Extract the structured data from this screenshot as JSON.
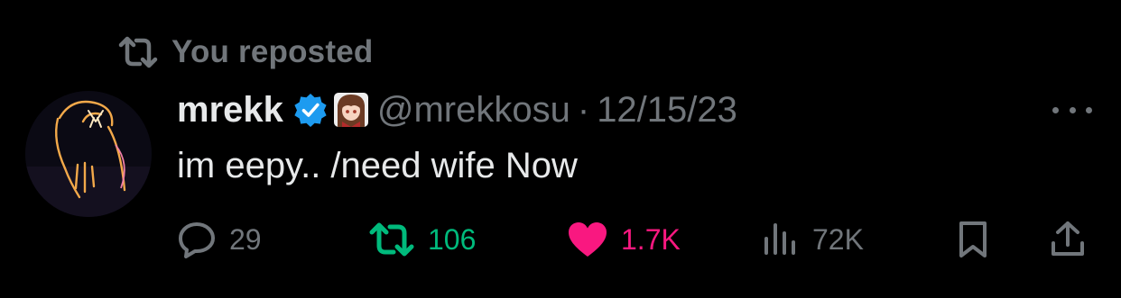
{
  "social_context": {
    "icon": "repost-icon",
    "text": "You reposted"
  },
  "author": {
    "display_name": "mrekk",
    "verified_icon": "verified-badge-icon",
    "badge_icon": "anime-girl-emoji-icon",
    "handle": "@mrekkosu",
    "separator": "·",
    "date": "12/15/23"
  },
  "tweet": {
    "text": "im eepy.. /need wife Now"
  },
  "actions": {
    "reply": {
      "icon": "reply-icon",
      "count": "29"
    },
    "repost": {
      "icon": "repost-icon",
      "count": "106"
    },
    "like": {
      "icon": "heart-icon",
      "count": "1.7K"
    },
    "views": {
      "icon": "views-icon",
      "count": "72K"
    },
    "bookmark": {
      "icon": "bookmark-icon"
    },
    "share": {
      "icon": "share-icon"
    },
    "more": {
      "icon": "more-icon"
    }
  },
  "colors": {
    "background": "#000000",
    "text_primary": "#e7e9ea",
    "text_secondary": "#71767b",
    "verified_blue": "#1d9bf0",
    "repost_green": "#00ba7c",
    "like_pink": "#f91880"
  }
}
